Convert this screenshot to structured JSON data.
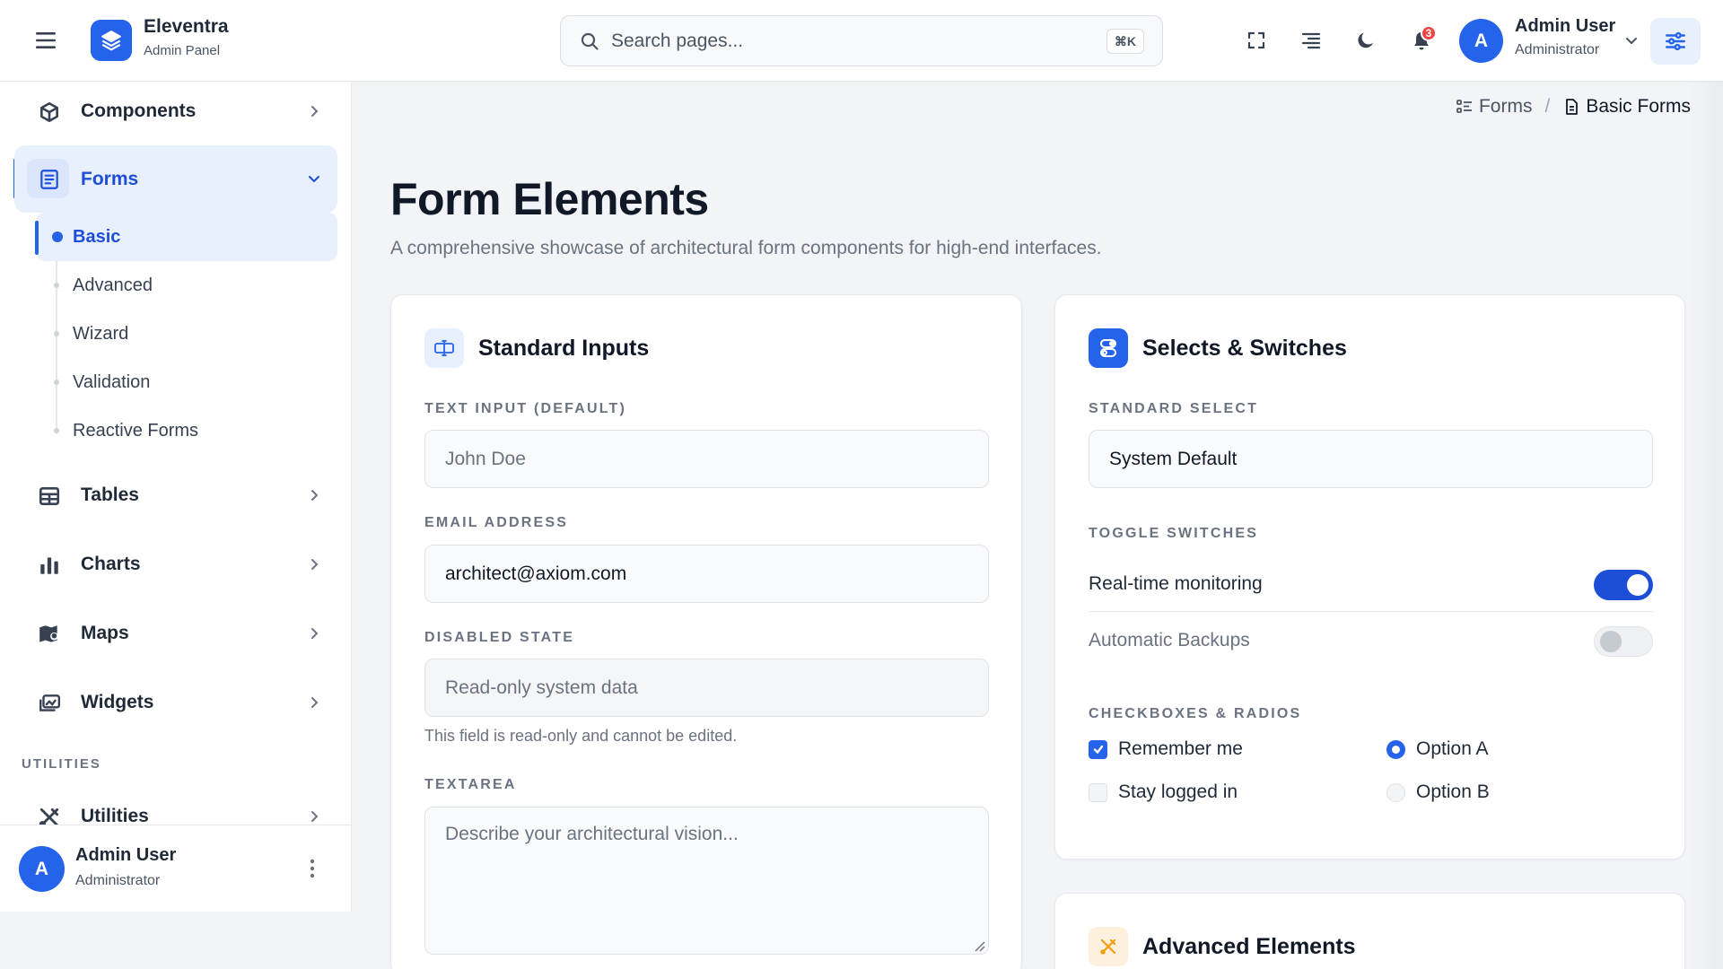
{
  "app": {
    "name": "Eleventra",
    "subtitle": "Admin Panel"
  },
  "search": {
    "placeholder": "Search pages...",
    "shortcut": "⌘K"
  },
  "header": {
    "notification_count": "3",
    "user": {
      "initial": "A",
      "name": "Admin User",
      "role": "Administrator"
    }
  },
  "sidebar": {
    "items": [
      {
        "label": "Components",
        "icon": "cube-icon"
      },
      {
        "label": "Forms",
        "icon": "form-icon",
        "active": true
      },
      {
        "label": "Tables",
        "icon": "table-icon"
      },
      {
        "label": "Charts",
        "icon": "bar-chart-icon"
      },
      {
        "label": "Maps",
        "icon": "map-icon"
      },
      {
        "label": "Widgets",
        "icon": "widgets-icon"
      },
      {
        "label": "Utilities",
        "icon": "tools-icon"
      }
    ],
    "forms_submenu": [
      "Basic",
      "Advanced",
      "Wizard",
      "Validation",
      "Reactive Forms"
    ],
    "section_utilities": "UTILITIES",
    "footer_user": {
      "initial": "A",
      "name": "Admin User",
      "role": "Administrator"
    }
  },
  "breadcrumb": {
    "parent": "Forms",
    "separator": "/",
    "current": "Basic Forms"
  },
  "page": {
    "title": "Form Elements",
    "subtitle": "A comprehensive showcase of architectural form components for high-end interfaces."
  },
  "standard_inputs": {
    "title": "Standard Inputs",
    "text_label": "TEXT INPUT (DEFAULT)",
    "text_placeholder": "John Doe",
    "email_label": "EMAIL ADDRESS",
    "email_value": "architect@axiom.com",
    "disabled_label": "DISABLED STATE",
    "disabled_placeholder": "Read-only system data",
    "disabled_hint": "This field is read-only and cannot be edited.",
    "textarea_label": "TEXTAREA",
    "textarea_placeholder": "Describe your architectural vision..."
  },
  "selects_switches": {
    "title": "Selects & Switches",
    "select_label": "STANDARD SELECT",
    "select_value": "System Default",
    "toggles_label": "TOGGLE SWITCHES",
    "toggles": [
      {
        "label": "Real-time monitoring",
        "on": true
      },
      {
        "label": "Automatic Backups",
        "on": false
      }
    ],
    "checks_label": "CHECKBOXES & RADIOS",
    "checkboxes": [
      {
        "label": "Remember me",
        "checked": true
      },
      {
        "label": "Stay logged in",
        "checked": false
      }
    ],
    "radios": [
      {
        "label": "Option A",
        "checked": true
      },
      {
        "label": "Option B",
        "checked": false
      }
    ]
  },
  "advanced_elements": {
    "title": "Advanced Elements"
  },
  "colors": {
    "accent": "#2563eb",
    "accent_light": "#e8effd",
    "badge": "#ef4444",
    "advanced_icon_bg": "#fdf0dc",
    "advanced_icon": "#f59e0b"
  }
}
